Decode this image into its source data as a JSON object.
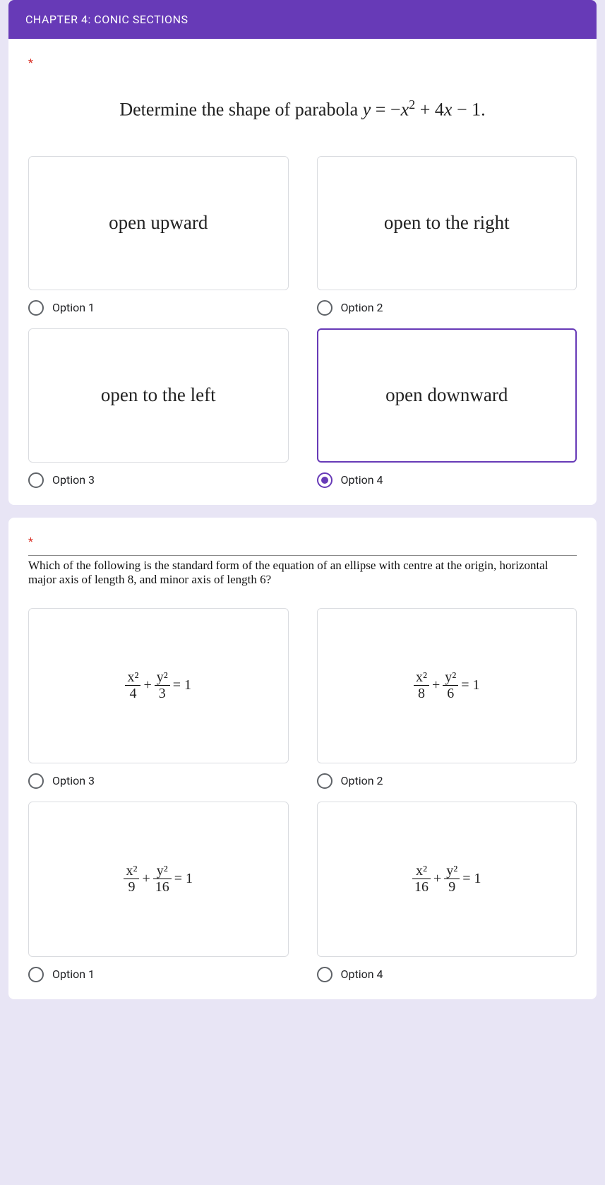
{
  "header": {
    "title": "CHAPTER 4: CONIC SECTIONS"
  },
  "q1": {
    "required": "*",
    "prompt": "Determine the shape of parabola y = −x² + 4x − 1.",
    "options": [
      {
        "box": "open upward",
        "label": "Option 1",
        "selected": false
      },
      {
        "box": "open to the right",
        "label": "Option 2",
        "selected": false
      },
      {
        "box": "open to the left",
        "label": "Option 3",
        "selected": false
      },
      {
        "box": "open downward",
        "label": "Option 4",
        "selected": true
      }
    ]
  },
  "q2": {
    "required": "*",
    "prompt": "Which of the following is the standard form of the equation of an ellipse with centre at the origin, horizontal major axis of length 8, and minor axis of length 6?",
    "options": [
      {
        "num1": "x²",
        "den1": "4",
        "num2": "y²",
        "den2": "3",
        "label": "Option 3",
        "selected": false
      },
      {
        "num1": "x²",
        "den1": "8",
        "num2": "y²",
        "den2": "6",
        "label": "Option 2",
        "selected": false
      },
      {
        "num1": "x²",
        "den1": "9",
        "num2": "y²",
        "den2": "16",
        "label": "Option 1",
        "selected": false
      },
      {
        "num1": "x²",
        "den1": "16",
        "num2": "y²",
        "den2": "9",
        "label": "Option 4",
        "selected": false
      }
    ],
    "plus": "+",
    "eq": "= 1"
  }
}
